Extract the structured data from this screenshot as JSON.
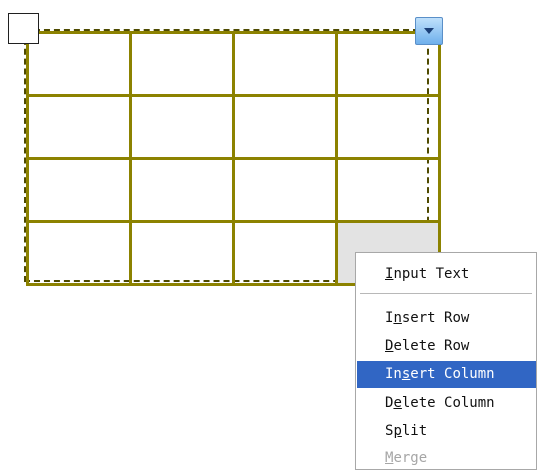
{
  "table": {
    "rows": 4,
    "columns": 4,
    "selected_cell": "row 4, column 4"
  },
  "icons": {
    "move_handle": "square-handle-icon",
    "menu_button": "chevron-down-icon"
  },
  "colors": {
    "grid_line": "#8c8200",
    "frame_border": "#4e4a00",
    "selected_cell": "#e3e3e3",
    "menu_highlight": "#3166c4",
    "disabled_text": "#a6a6a6"
  },
  "context_menu": {
    "items": [
      {
        "pre": "",
        "acc": "I",
        "post": "nput Text"
      },
      {
        "pre": "I",
        "acc": "n",
        "post": "sert Row"
      },
      {
        "pre": "",
        "acc": "D",
        "post": "elete Row"
      },
      {
        "pre": "In",
        "acc": "s",
        "post": "ert Column"
      },
      {
        "pre": "D",
        "acc": "e",
        "post": "lete Column"
      },
      {
        "pre": "S",
        "acc": "p",
        "post": "lit"
      },
      {
        "pre": "",
        "acc": "M",
        "post": "erge"
      }
    ],
    "highlighted_item": "Insert Column",
    "disabled_item": "Merge"
  }
}
